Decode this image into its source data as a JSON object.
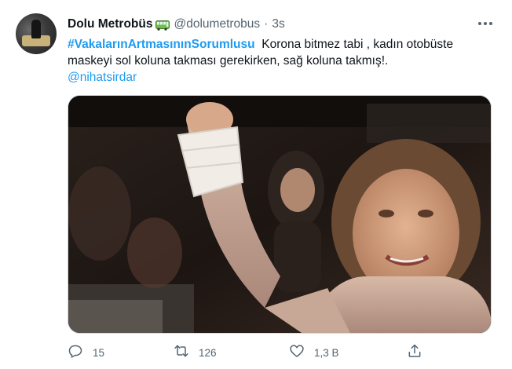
{
  "tweet": {
    "author_name": "Dolu Metrobüs",
    "handle": "@dolumetrobus",
    "separator": "·",
    "time": "3s",
    "hashtag": "#VakalarınArtmasınınSorumlusu",
    "body_line1": "Korona bitmez tabi , kadın otobüste",
    "body_line2": "maskeyi sol koluna takması gerekirken, sağ koluna takmış!.",
    "mention": "@nihatsirdar"
  },
  "actions": {
    "reply_count": "15",
    "retweet_count": "126",
    "like_count": "1,3 B"
  },
  "icons": {
    "reply": "reply-icon",
    "retweet": "retweet-icon",
    "like": "like-icon",
    "share": "share-icon",
    "more": "more-icon",
    "bus": "bus-emoji-icon"
  },
  "colors": {
    "link": "#1d9bf0",
    "secondary_text": "#536471",
    "primary_text": "#0f1419"
  }
}
